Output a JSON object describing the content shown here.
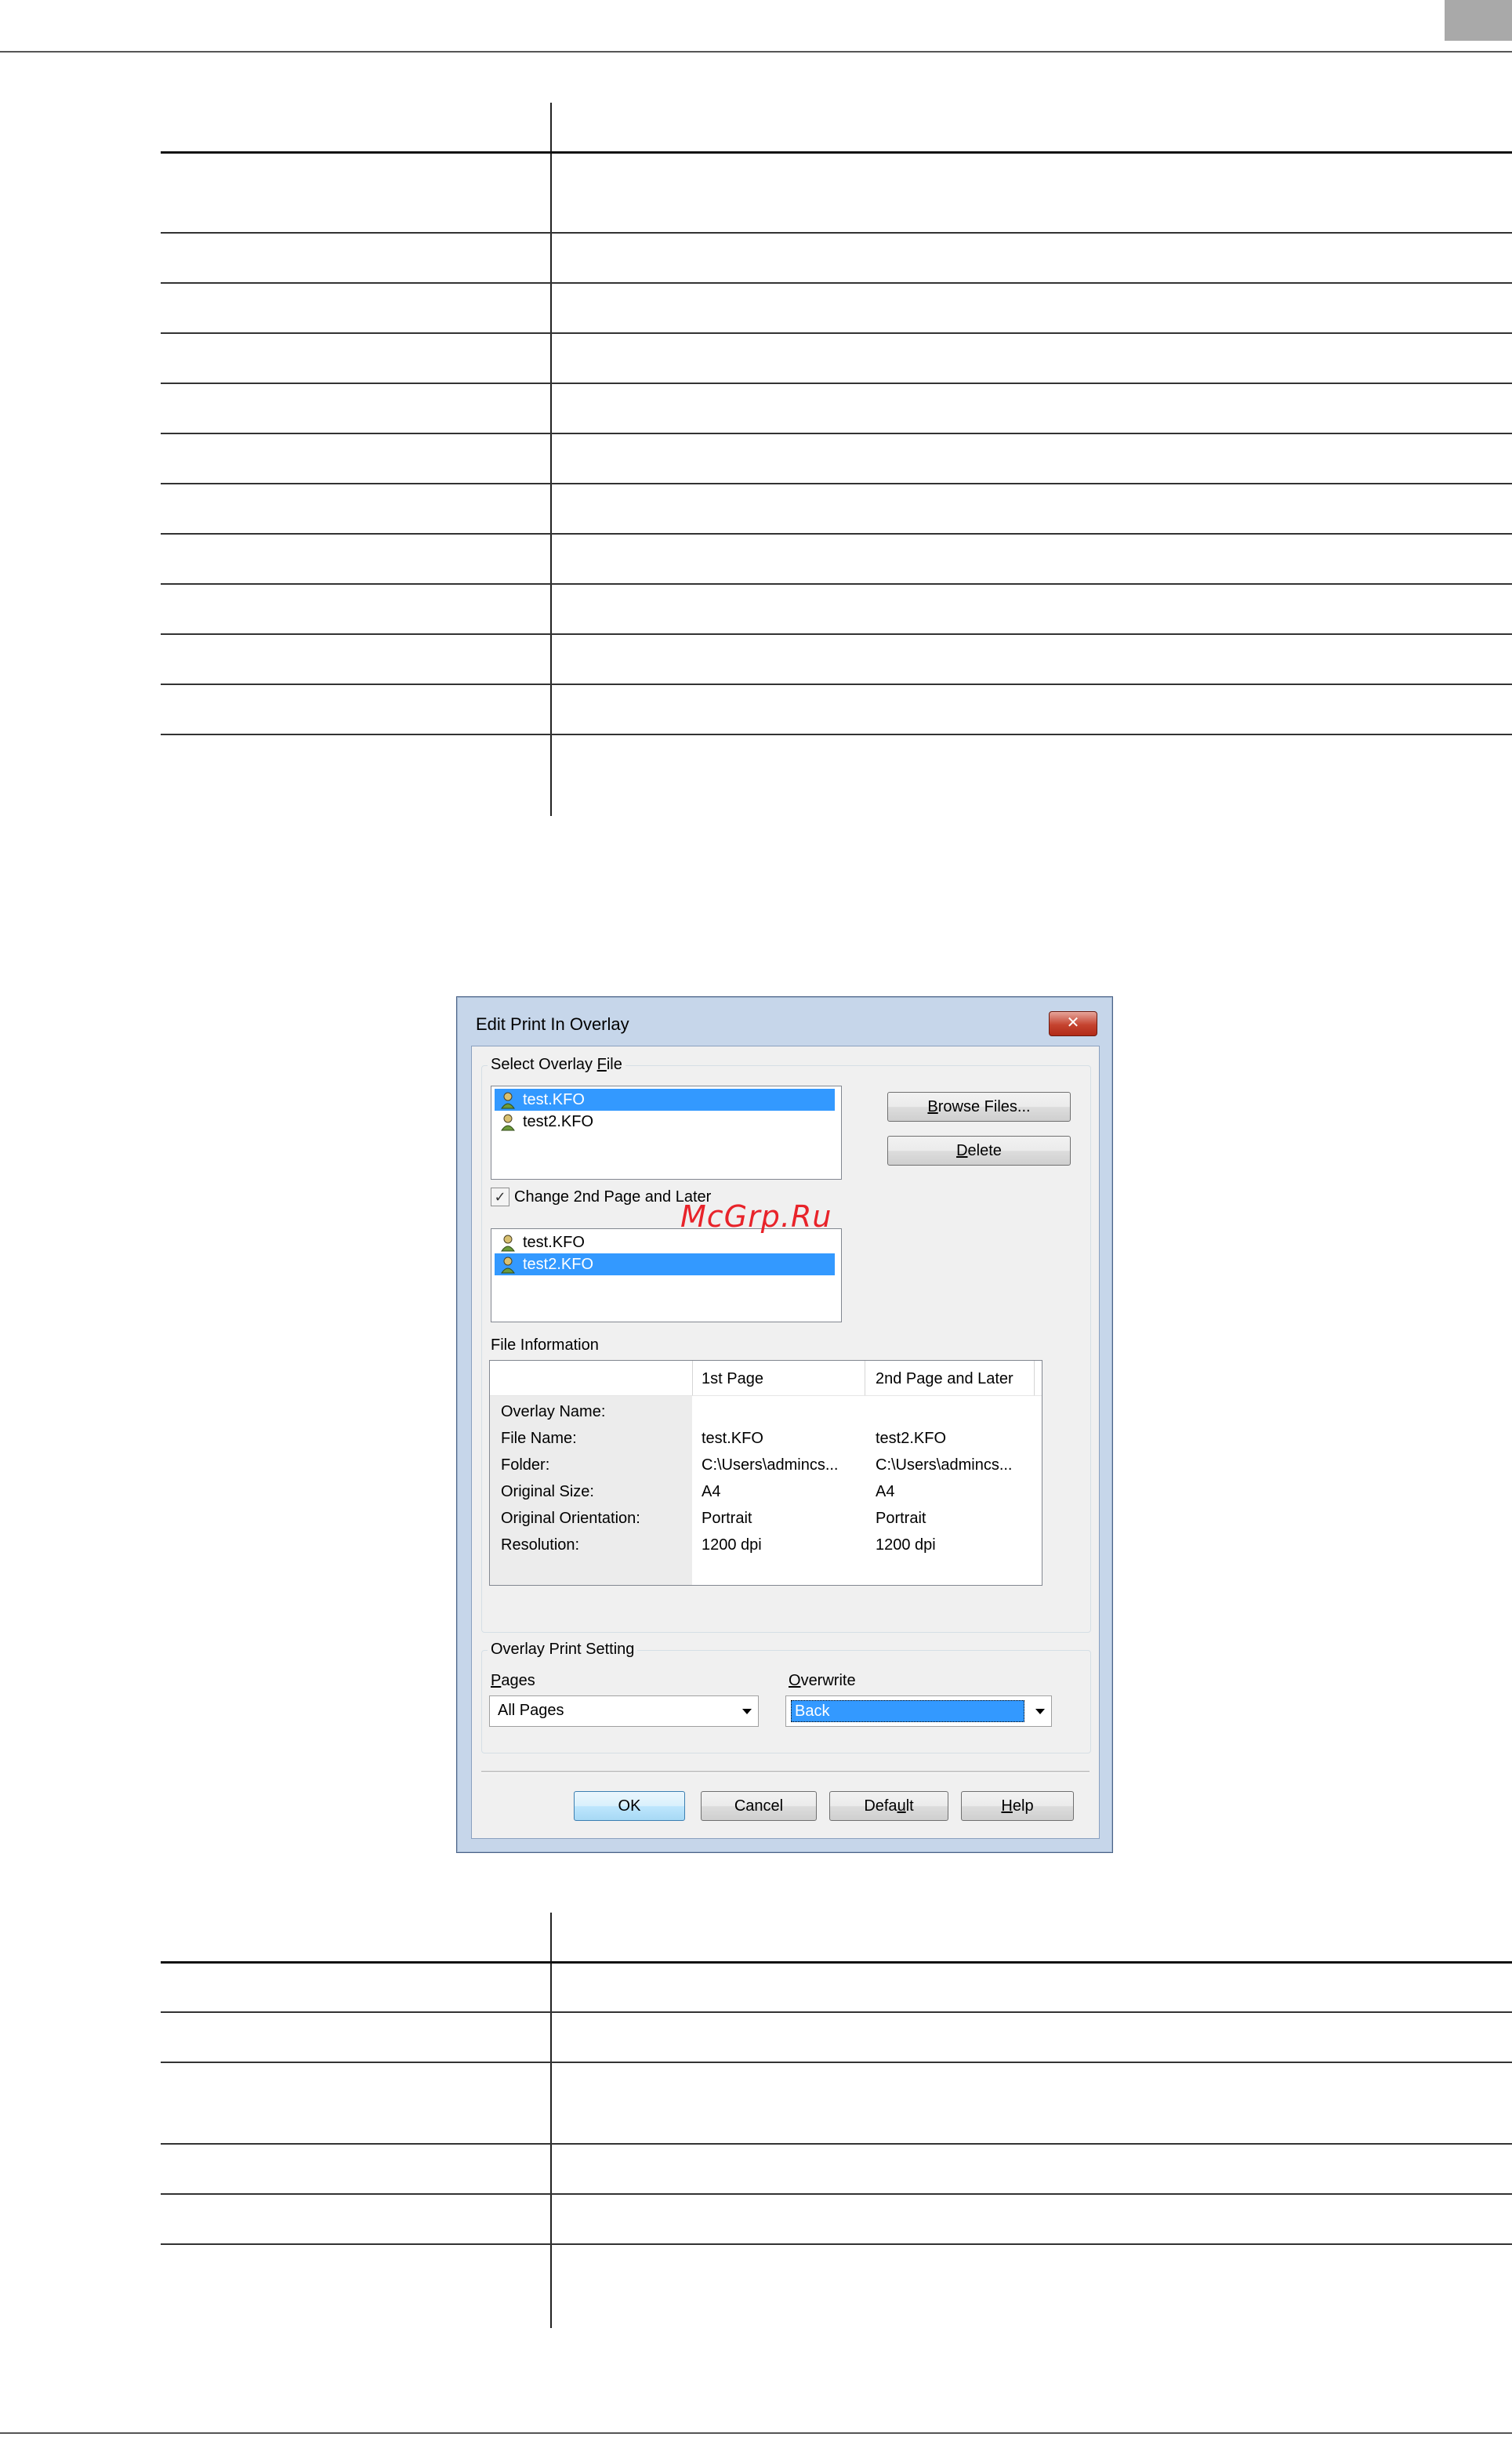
{
  "watermark": "McGrp.Ru",
  "dialog": {
    "title": "Edit Print In Overlay",
    "close_symbol": "✕",
    "select_group": {
      "label_pre": "Select Overlay ",
      "label_ul": "F",
      "label_post": "ile"
    },
    "files_first": [
      "test.KFO",
      "test2.KFO"
    ],
    "browse": {
      "pre": "",
      "ul": "B",
      "post": "rowse Files..."
    },
    "delete": {
      "pre": "",
      "ul": "D",
      "post": "elete"
    },
    "change2nd": {
      "checked_symbol": "✓",
      "label": "Change 2nd Page and Later"
    },
    "files_second": [
      "test.KFO",
      "test2.KFO"
    ],
    "file_info": {
      "title": "File Information",
      "col1": "1st Page",
      "col2": "2nd Page and Later",
      "rows": [
        {
          "label": "Overlay Name:",
          "v1": "",
          "v2": ""
        },
        {
          "label": "File Name:",
          "v1": "test.KFO",
          "v2": "test2.KFO"
        },
        {
          "label": "Folder:",
          "v1": "C:\\Users\\admincs...",
          "v2": "C:\\Users\\admincs..."
        },
        {
          "label": "Original Size:",
          "v1": "A4",
          "v2": "A4"
        },
        {
          "label": "Original Orientation:",
          "v1": "Portrait",
          "v2": "Portrait"
        },
        {
          "label": "Resolution:",
          "v1": "1200 dpi",
          "v2": "1200 dpi"
        }
      ]
    },
    "print_setting": {
      "label": "Overlay Print Setting",
      "pages": {
        "ul": "P",
        "post": "ages",
        "value": "All Pages"
      },
      "overwrite": {
        "ul": "O",
        "post": "verwrite",
        "value": "Back"
      }
    },
    "buttons": {
      "ok": "OK",
      "cancel": "Cancel",
      "default": {
        "pre": "Defa",
        "ul": "u",
        "post": "lt"
      },
      "help": {
        "pre": "",
        "ul": "H",
        "post": "elp"
      }
    }
  },
  "colors": {
    "selection": "#3399ff",
    "watermark": "#e8232a",
    "close_button": "#c5432f"
  },
  "icons": [
    "overlay-file-icon",
    "close-icon",
    "checkbox-check-icon",
    "dropdown-arrow-icon"
  ]
}
